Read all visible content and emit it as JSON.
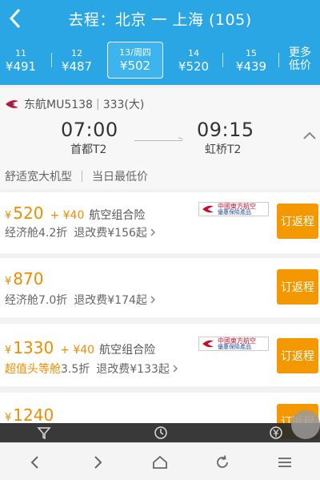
{
  "header": {
    "title": "去程：北京 一 上海 (105)"
  },
  "dates": [
    {
      "day": "11",
      "price": "¥491"
    },
    {
      "day": "12",
      "price": "¥487"
    },
    {
      "day": "13/周四",
      "price": "¥502"
    },
    {
      "day": "14",
      "price": "¥520"
    },
    {
      "day": "15",
      "price": "¥439"
    }
  ],
  "more": {
    "line1": "更多",
    "line2": "低价"
  },
  "flight": {
    "airline": "东航MU5138",
    "aircraft": "333(大)",
    "depart_time": "07:00",
    "depart_airport": "首都T2",
    "arrive_time": "09:15",
    "arrive_airport": "虹桥T2",
    "feature1": "舒适宽大机型",
    "feature2": "当日最低价"
  },
  "fares": [
    {
      "yen": "¥",
      "price": "520",
      "addon": "+ ¥40",
      "addon_label": "航空组合险",
      "cabin": "经济舱4.2折",
      "fee": "退改费¥156起",
      "book": "订返程",
      "badge_l1": "中國東方航空",
      "badge_l2": "優惠保險產品"
    },
    {
      "yen": "¥",
      "price": "870",
      "cabin": "经济舱7.0折",
      "fee": "退改费¥174起",
      "book": "订返程"
    },
    {
      "yen": "¥",
      "price": "1330",
      "addon": "+ ¥40",
      "addon_label": "航空组合险",
      "cabin_highlight": "超值头等舱",
      "cabin": "3.5折",
      "fee": "退改费¥133起",
      "book": "订返程",
      "badge_l1": "中國東方航空",
      "badge_l2": "優惠保險產品"
    },
    {
      "yen": "¥",
      "price": "1240",
      "book": "订返程"
    }
  ],
  "icons": {
    "back": "chevron-left-icon",
    "collapse": "chevron-up-icon",
    "filter": "filter-icon",
    "clock": "clock-icon",
    "price": "yen-icon"
  },
  "colors": {
    "primary": "#2ba6e4",
    "accent": "#f39800",
    "price": "#f08c00"
  }
}
